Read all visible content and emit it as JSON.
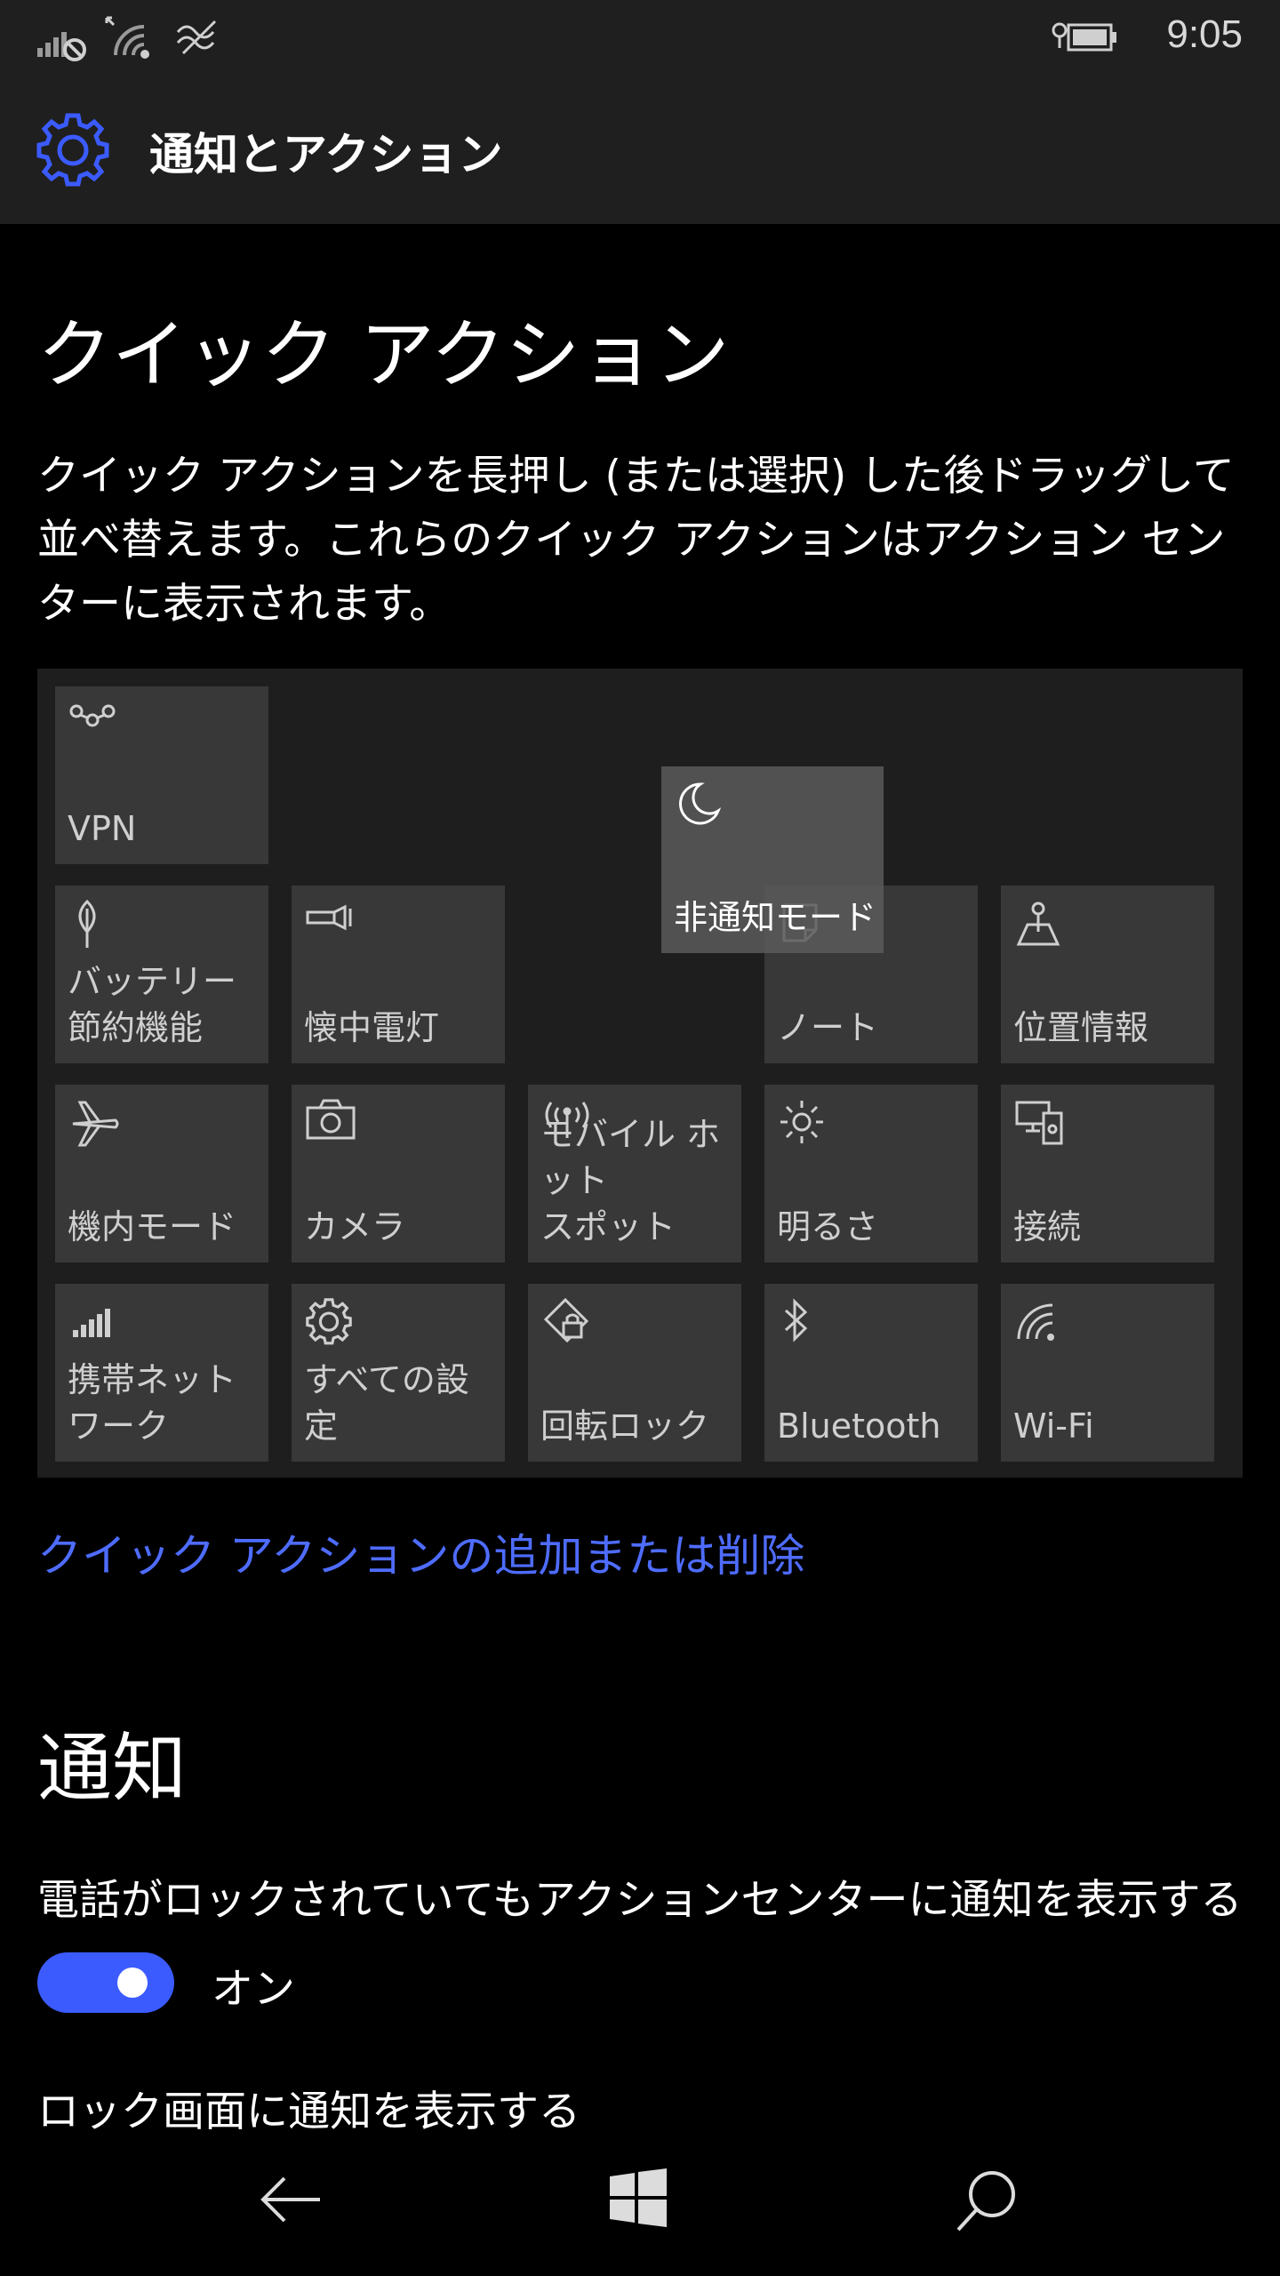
{
  "status": {
    "time": "9:05",
    "icons": [
      "signal-off-icon",
      "wifi-icon",
      "wifi-calling-icon",
      "battery-charging-icon"
    ]
  },
  "app": {
    "title": "通知とアクション",
    "icon": "gear-icon",
    "accent": "#3b5bff"
  },
  "quick_actions": {
    "heading": "クイック アクション",
    "description": "クイック アクションを長押し (または選択) した後ドラッグして並べ替えます。これらのクイック アクションはアクション センターに表示されます。",
    "tiles": [
      {
        "label": "VPN",
        "icon": "vpn-icon"
      },
      {
        "label": "バッテリー\n節約機能",
        "icon": "battery-saver-icon"
      },
      {
        "label": "懐中電灯",
        "icon": "flashlight-icon"
      },
      {
        "label": "ノート",
        "icon": "note-icon"
      },
      {
        "label": "位置情報",
        "icon": "location-icon"
      },
      {
        "label": "機内モード",
        "icon": "airplane-icon"
      },
      {
        "label": "カメラ",
        "icon": "camera-icon"
      },
      {
        "label": "モバイル ホット\nスポット",
        "icon": "hotspot-icon"
      },
      {
        "label": "明るさ",
        "icon": "brightness-icon"
      },
      {
        "label": "接続",
        "icon": "connect-icon"
      },
      {
        "label": "携帯ネット\nワーク",
        "icon": "cellular-icon"
      },
      {
        "label": "すべての設定",
        "icon": "gear-icon"
      },
      {
        "label": "回転ロック",
        "icon": "rotation-lock-icon"
      },
      {
        "label": "Bluetooth",
        "icon": "bluetooth-icon"
      },
      {
        "label": "Wi-Fi",
        "icon": "wifi-icon"
      }
    ],
    "dragging_tile": {
      "label": "非通知モード",
      "icon": "moon-icon"
    },
    "link": "クイック アクションの追加または削除"
  },
  "notifications": {
    "heading": "通知",
    "show_on_lock_action_center": {
      "label": "電話がロックされていてもアクションセンターに通知を表示する",
      "state": "オン",
      "on": true
    },
    "show_on_lock_screen": {
      "label": "ロック画面に通知を表示する"
    }
  },
  "navbar": {
    "icons": [
      "back-arrow-icon",
      "windows-start-icon",
      "search-icon"
    ]
  }
}
